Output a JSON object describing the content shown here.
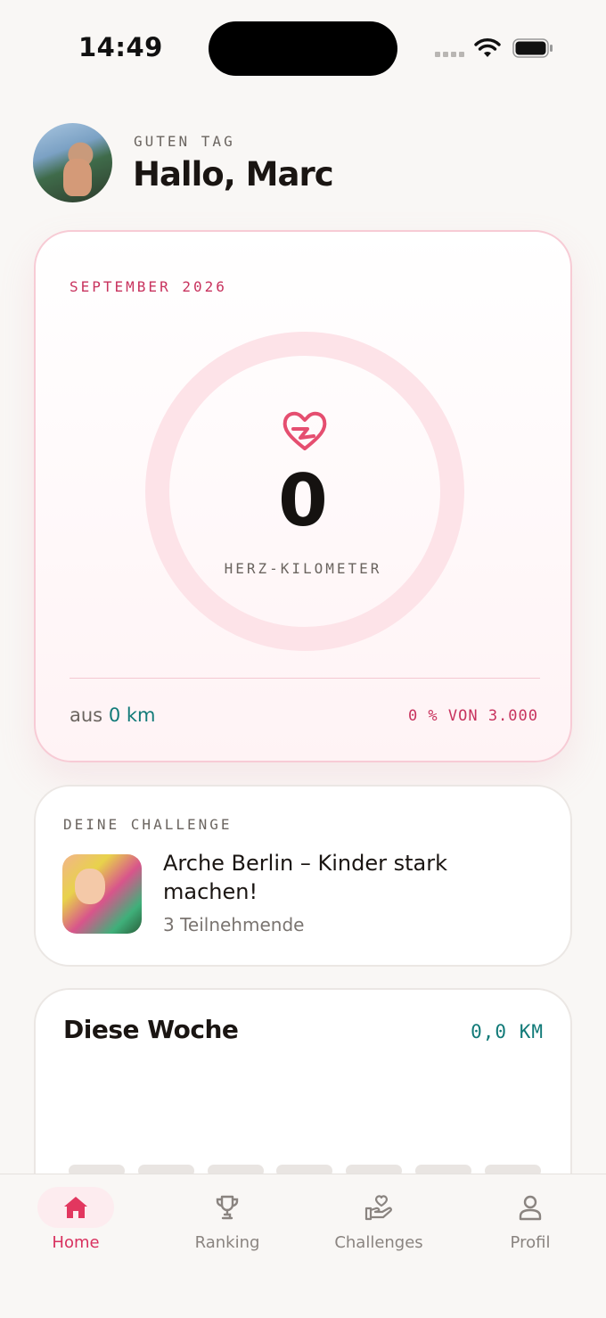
{
  "status_bar": {
    "time": "14:49"
  },
  "header": {
    "eyebrow": "GUTEN TAG",
    "title": "Hallo, Marc"
  },
  "month_card": {
    "month": "SEPTEMBER 2026",
    "value": "0",
    "unit": "HERZ-KILOMETER",
    "from_prefix": "aus",
    "from_value": "0 km",
    "progress": "0 % VON 3.000",
    "progress_fraction": 0
  },
  "challenge_card": {
    "eyebrow": "DEINE CHALLENGE",
    "title": "Arche Berlin – Kinder stark machen!",
    "participants": "3 Teilnehmende"
  },
  "week_card": {
    "title": "Diese Woche",
    "total": "0,0 KM",
    "days": [
      0,
      0,
      0,
      0,
      0,
      0,
      0
    ]
  },
  "tab_bar": {
    "tabs": [
      {
        "label": "Home",
        "icon": "home-icon",
        "active": true
      },
      {
        "label": "Ranking",
        "icon": "trophy-icon",
        "active": false
      },
      {
        "label": "Challenges",
        "icon": "hand-heart-icon",
        "active": false
      },
      {
        "label": "Profil",
        "icon": "user-icon",
        "active": false
      }
    ]
  },
  "colors": {
    "accent": "#d8315f",
    "teal": "#117a78",
    "ring": "#fde3e8",
    "background": "#f9f7f5"
  }
}
